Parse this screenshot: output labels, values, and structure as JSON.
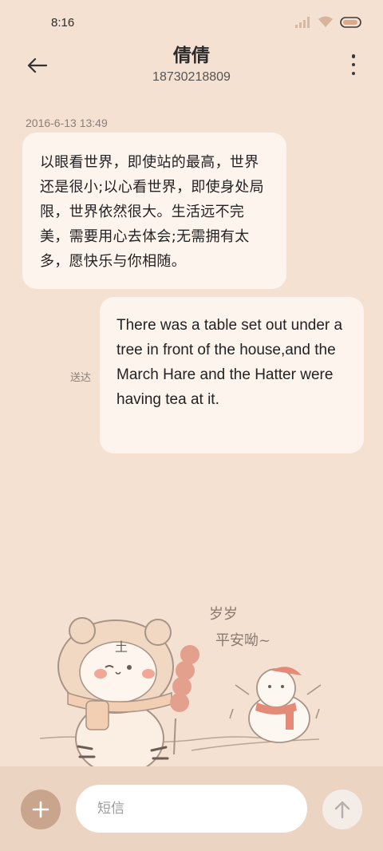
{
  "status_bar": {
    "time": "8:16",
    "icons": [
      "signal-icon",
      "wifi-icon",
      "battery-icon"
    ]
  },
  "header": {
    "contact_name": "倩倩",
    "phone_number": "18730218809",
    "back_icon": "arrow-left-icon",
    "more_icon": "more-vertical-icon"
  },
  "messages": [
    {
      "direction": "incoming",
      "timestamp": "2016-6-13 13:49",
      "text": "以眼看世界，即使站的最高，世界还是很小;以心看世界，即使身处局限，世界依然很大。生活远不完美，需要用心去体会;无需拥有太多，愿快乐与你相随。"
    },
    {
      "direction": "outgoing",
      "status": "送达",
      "text": "There was a table set out under a tree in front of the house,and the March Hare and the Hatter were having tea at it."
    }
  ],
  "illustration": {
    "caption_line1": "岁岁",
    "caption_line2": "平安呦~",
    "seal_text": "土"
  },
  "composer": {
    "placeholder": "短信",
    "add_icon": "plus-icon",
    "send_icon": "arrow-up-icon"
  },
  "colors": {
    "background": "#f4e1d2",
    "bubble": "#fdf4ee",
    "composer_bar": "#ecd4c3",
    "add_button": "#c9a58d"
  }
}
